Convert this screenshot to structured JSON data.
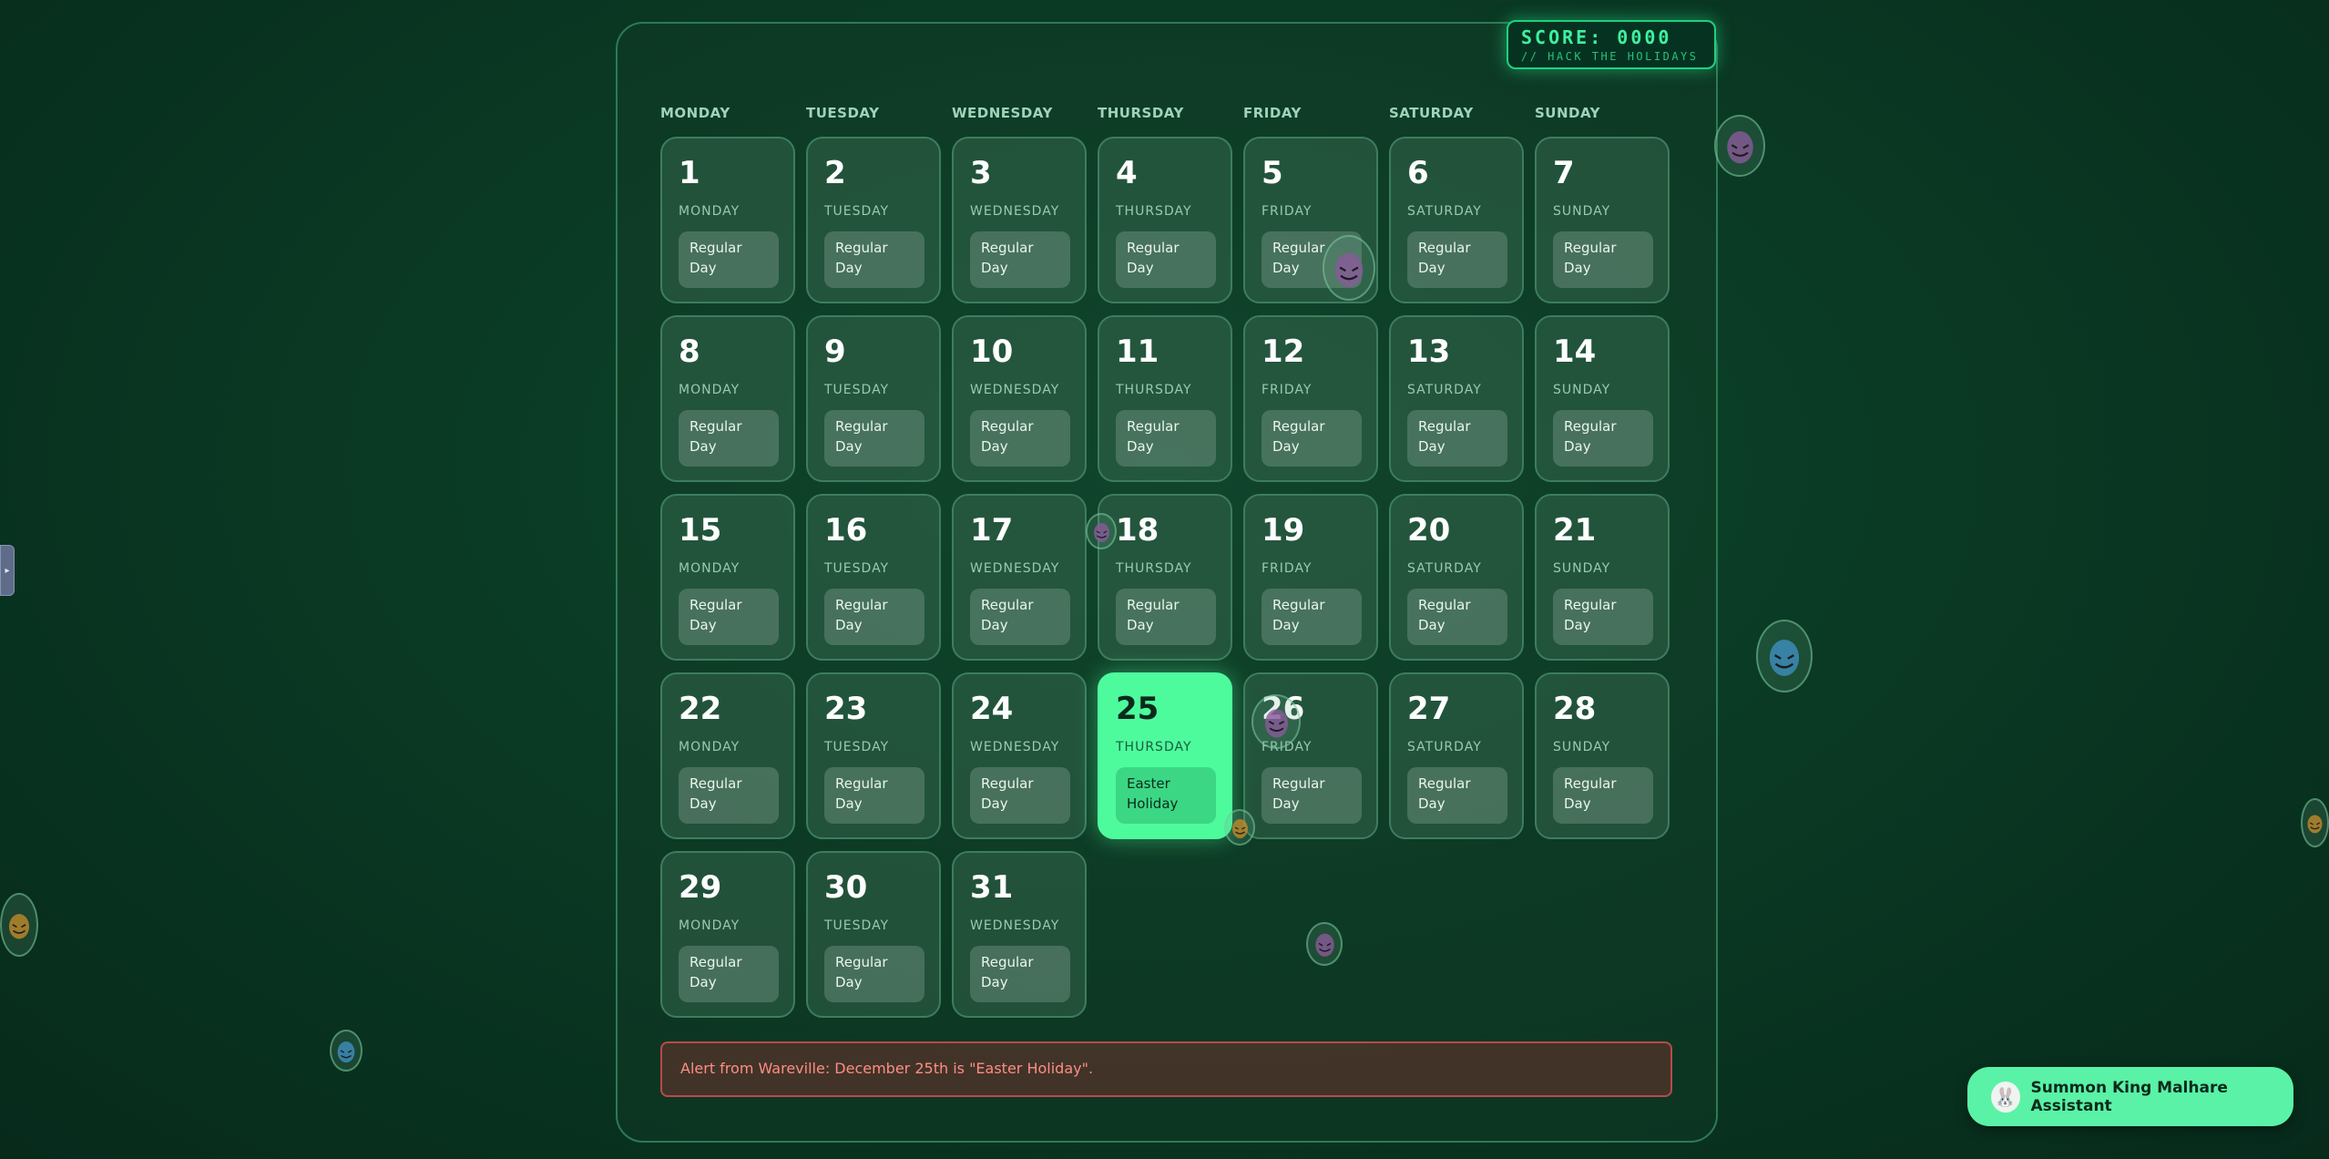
{
  "score": {
    "title": "SCORE: 0000",
    "subtitle": "// HACK THE HOLIDAYS"
  },
  "weekdays": [
    "MONDAY",
    "TUESDAY",
    "WEDNESDAY",
    "THURSDAY",
    "FRIDAY",
    "SATURDAY",
    "SUNDAY"
  ],
  "days": [
    {
      "num": "1",
      "weekday": "MONDAY",
      "label": "Regular Day"
    },
    {
      "num": "2",
      "weekday": "TUESDAY",
      "label": "Regular Day"
    },
    {
      "num": "3",
      "weekday": "WEDNESDAY",
      "label": "Regular Day"
    },
    {
      "num": "4",
      "weekday": "THURSDAY",
      "label": "Regular Day"
    },
    {
      "num": "5",
      "weekday": "FRIDAY",
      "label": "Regular Day"
    },
    {
      "num": "6",
      "weekday": "SATURDAY",
      "label": "Regular Day"
    },
    {
      "num": "7",
      "weekday": "SUNDAY",
      "label": "Regular Day"
    },
    {
      "num": "8",
      "weekday": "MONDAY",
      "label": "Regular Day"
    },
    {
      "num": "9",
      "weekday": "TUESDAY",
      "label": "Regular Day"
    },
    {
      "num": "10",
      "weekday": "WEDNESDAY",
      "label": "Regular Day"
    },
    {
      "num": "11",
      "weekday": "THURSDAY",
      "label": "Regular Day"
    },
    {
      "num": "12",
      "weekday": "FRIDAY",
      "label": "Regular Day"
    },
    {
      "num": "13",
      "weekday": "SATURDAY",
      "label": "Regular Day"
    },
    {
      "num": "14",
      "weekday": "SUNDAY",
      "label": "Regular Day"
    },
    {
      "num": "15",
      "weekday": "MONDAY",
      "label": "Regular Day"
    },
    {
      "num": "16",
      "weekday": "TUESDAY",
      "label": "Regular Day"
    },
    {
      "num": "17",
      "weekday": "WEDNESDAY",
      "label": "Regular Day"
    },
    {
      "num": "18",
      "weekday": "THURSDAY",
      "label": "Regular Day"
    },
    {
      "num": "19",
      "weekday": "FRIDAY",
      "label": "Regular Day"
    },
    {
      "num": "20",
      "weekday": "SATURDAY",
      "label": "Regular Day"
    },
    {
      "num": "21",
      "weekday": "SUNDAY",
      "label": "Regular Day"
    },
    {
      "num": "22",
      "weekday": "MONDAY",
      "label": "Regular Day"
    },
    {
      "num": "23",
      "weekday": "TUESDAY",
      "label": "Regular Day"
    },
    {
      "num": "24",
      "weekday": "WEDNESDAY",
      "label": "Regular Day"
    },
    {
      "num": "25",
      "weekday": "THURSDAY",
      "label": "Easter Holiday",
      "holiday": true
    },
    {
      "num": "26",
      "weekday": "FRIDAY",
      "label": "Regular Day"
    },
    {
      "num": "27",
      "weekday": "SATURDAY",
      "label": "Regular Day"
    },
    {
      "num": "28",
      "weekday": "SUNDAY",
      "label": "Regular Day"
    },
    {
      "num": "29",
      "weekday": "MONDAY",
      "label": "Regular Day"
    },
    {
      "num": "30",
      "weekday": "TUESDAY",
      "label": "Regular Day"
    },
    {
      "num": "31",
      "weekday": "WEDNESDAY",
      "label": "Regular Day"
    }
  ],
  "alert": "Alert from Wareville: December 25th is \"Easter Holiday\".",
  "assistant": {
    "label": "Summon King Malhare Assistant",
    "avatar_icon": "bunny-king-avatar-icon"
  },
  "colors": {
    "accent": "#4dfb9d",
    "alert_text": "#ff8d84",
    "score_text": "#3ff0a0"
  },
  "floating_eggs": [
    {
      "icon": "purple-egg-icon",
      "color": "#8a5a9a"
    },
    {
      "icon": "purple-egg-icon",
      "color": "#8a5a9a"
    },
    {
      "icon": "purple-egg-icon",
      "color": "#8a5a9a"
    },
    {
      "icon": "purple-egg-icon",
      "color": "#8a5a9a"
    },
    {
      "icon": "purple-egg-icon",
      "color": "#8a5a9a"
    },
    {
      "icon": "blue-egg-icon",
      "color": "#3f8fc0"
    },
    {
      "icon": "blue-egg-icon",
      "color": "#3f8fc0"
    },
    {
      "icon": "orange-egg-icon",
      "color": "#c08a2a"
    },
    {
      "icon": "orange-egg-icon",
      "color": "#c08a2a"
    },
    {
      "icon": "orange-egg-icon",
      "color": "#c08a2a"
    }
  ]
}
